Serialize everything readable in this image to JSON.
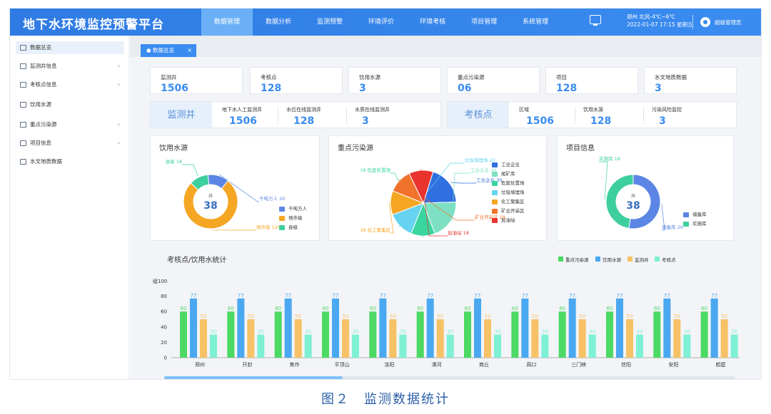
{
  "header": {
    "brand": "地下水环境监控预警平台",
    "nav": [
      {
        "label": "数据管理",
        "active": true
      },
      {
        "label": "数据分析",
        "active": false
      },
      {
        "label": "监测预警",
        "active": false
      },
      {
        "label": "环境评价",
        "active": false
      },
      {
        "label": "环境考核",
        "active": false
      },
      {
        "label": "项目管理",
        "active": false
      },
      {
        "label": "系统管理",
        "active": false
      }
    ],
    "weather": "郑州 北风-4℃~6℃",
    "datetime": "2022-01-07 17:15 星期五",
    "user": "超级管理员"
  },
  "sidebar": [
    {
      "label": "数据总览",
      "icon": "edit-icon",
      "arrow": false,
      "active": true
    },
    {
      "label": "监测井信息",
      "icon": "well-icon",
      "arrow": true,
      "active": false
    },
    {
      "label": "考核点信息",
      "icon": "monitor-icon",
      "arrow": true,
      "active": false
    },
    {
      "label": "饮用水源",
      "icon": "water-icon",
      "arrow": false,
      "active": false
    },
    {
      "label": "重点污染源",
      "icon": "pollution-icon",
      "arrow": true,
      "active": false
    },
    {
      "label": "项目信息",
      "icon": "folder-icon",
      "arrow": true,
      "active": false
    },
    {
      "label": "水文地质数据",
      "icon": "data-icon",
      "arrow": false,
      "active": false
    }
  ],
  "tab": {
    "label": "● 数据总览",
    "close": "×"
  },
  "stats": [
    {
      "label": "监测井",
      "value": "1506"
    },
    {
      "label": "考核点",
      "value": "128"
    },
    {
      "label": "饮用水源",
      "value": "3"
    },
    {
      "label": "重点污染源",
      "value": "06"
    },
    {
      "label": "项目",
      "value": "128"
    },
    {
      "label": "水文地质数据",
      "value": "3"
    }
  ],
  "band_left": {
    "head": "监测井",
    "cells": [
      {
        "label": "地下水人工监测井",
        "value": "1506"
      },
      {
        "label": "水位在线监测井",
        "value": "128"
      },
      {
        "label": "水质在线监测井",
        "value": "3"
      }
    ]
  },
  "band_right": {
    "head": "考核点",
    "cells": [
      {
        "label": "区域",
        "value": "1506"
      },
      {
        "label": "饮用水源",
        "value": "128"
      },
      {
        "label": "污染风险监控",
        "value": "3"
      }
    ]
  },
  "panels": {
    "water": {
      "title": "饮用水源",
      "center_top": "共",
      "center_val": "38",
      "slices": [
        {
          "name": "千吨万人",
          "value": 20,
          "color": "#5b86e5",
          "label": "千吨万人 20"
        },
        {
          "name": "地市级",
          "value": 120,
          "color": "#f5a623",
          "label": "地市级 120"
        },
        {
          "name": "县级",
          "value": 18,
          "color": "#3ecf9e",
          "label": "县级 18"
        }
      ]
    },
    "pollution": {
      "title": "重点污染源",
      "slices": [
        {
          "name": "工业企业",
          "value": 30,
          "color": "#2f6fe0",
          "label": "工业企业 30"
        },
        {
          "name": "尾矿库",
          "value": 30,
          "color": "#7de0c2",
          "label": "工业企业 30"
        },
        {
          "name": "危废处置场",
          "value": 18,
          "color": "#3bd69f",
          "label": "18 危废处置场"
        },
        {
          "name": "垃圾填埋场",
          "value": 20,
          "color": "#66d3f0",
          "label": "垃圾填埋场 20"
        },
        {
          "name": "化工聚集区",
          "value": 18,
          "color": "#f5a623",
          "label": "18 化工聚集区"
        },
        {
          "name": "矿业开采区",
          "value": 18,
          "color": "#f0722b",
          "label": "矿业开采区 18"
        },
        {
          "name": "加油站",
          "value": 18,
          "color": "#e8332f",
          "label": "加油站 18"
        }
      ]
    },
    "project": {
      "title": "项目信息",
      "center_top": "共",
      "center_val": "38",
      "slices": [
        {
          "name": "储备库",
          "value": 20,
          "color": "#5b86e5",
          "label": "储备库 20"
        },
        {
          "name": "实施库",
          "value": 18,
          "color": "#3ecf9e",
          "label": "实施库 18"
        }
      ]
    }
  },
  "chart_data": {
    "type": "bar",
    "title": "考核点/饮用水统计",
    "ylabel": "组",
    "ylim": [
      0,
      100
    ],
    "yticks": [
      "100",
      "80",
      "60",
      "40",
      "20",
      "0"
    ],
    "categories": [
      "郑州",
      "开封",
      "焦作",
      "平顶山",
      "洛阳",
      "漯河",
      "商丘",
      "周口",
      "三门峡",
      "信阳",
      "安阳",
      "鹤壁"
    ],
    "series": [
      {
        "name": "重点污染源",
        "color": "#4cd964",
        "values": [
          60,
          60,
          60,
          60,
          60,
          60,
          60,
          60,
          60,
          60,
          60,
          60
        ]
      },
      {
        "name": "饮用水源",
        "color": "#4aa8f0",
        "values": [
          77,
          77,
          77,
          77,
          77,
          77,
          77,
          77,
          77,
          77,
          77,
          77
        ]
      },
      {
        "name": "监测井",
        "color": "#f7c266",
        "values": [
          50,
          50,
          50,
          50,
          50,
          50,
          50,
          50,
          50,
          50,
          50,
          50
        ]
      },
      {
        "name": "考核点",
        "color": "#7ef0d4",
        "values": [
          30,
          30,
          30,
          30,
          30,
          30,
          30,
          30,
          30,
          30,
          30,
          30
        ]
      }
    ]
  },
  "caption": "图２　监测数据统计"
}
